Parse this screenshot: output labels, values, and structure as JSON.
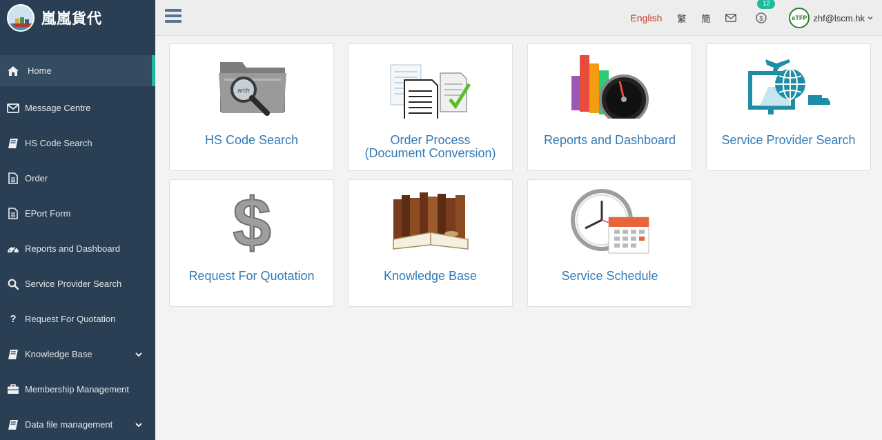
{
  "brand": {
    "title": "嵐嵐貨代"
  },
  "sidebar": {
    "items": [
      {
        "label": "Home",
        "icon": "home-icon"
      },
      {
        "label": "Message Centre",
        "icon": "envelope-icon"
      },
      {
        "label": "HS Code Search",
        "icon": "book-icon"
      },
      {
        "label": "Order",
        "icon": "document-icon"
      },
      {
        "label": "EPort Form",
        "icon": "document-icon"
      },
      {
        "label": "Reports and Dashboard",
        "icon": "dashboard-icon"
      },
      {
        "label": "Service Provider Search",
        "icon": "search-icon"
      },
      {
        "label": "Request For Quotation",
        "icon": "question-icon"
      },
      {
        "label": "Knowledge Base",
        "icon": "book-icon"
      },
      {
        "label": "Membership Management",
        "icon": "briefcase-icon"
      },
      {
        "label": "Data file management",
        "icon": "book-icon"
      }
    ]
  },
  "topbar": {
    "lang_en": "English",
    "lang_tc": "繁",
    "lang_sc": "簡",
    "notification_count": "12",
    "avatar_text": "eTFP",
    "user_email": "zhf@lscm.hk"
  },
  "cards": [
    {
      "label": "HS Code Search"
    },
    {
      "label_line1": "Order Process",
      "label_line2": "(Document Conversion)"
    },
    {
      "label": "Reports and Dashboard"
    },
    {
      "label": "Service Provider Search"
    },
    {
      "label": "Request For Quotation"
    },
    {
      "label": "Knowledge Base"
    },
    {
      "label": "Service Schedule"
    }
  ],
  "colors": {
    "sidebar_bg": "#2a3f54",
    "active_accent": "#1abb9c",
    "card_text": "#337ab7",
    "lang_active": "#c0392b"
  }
}
